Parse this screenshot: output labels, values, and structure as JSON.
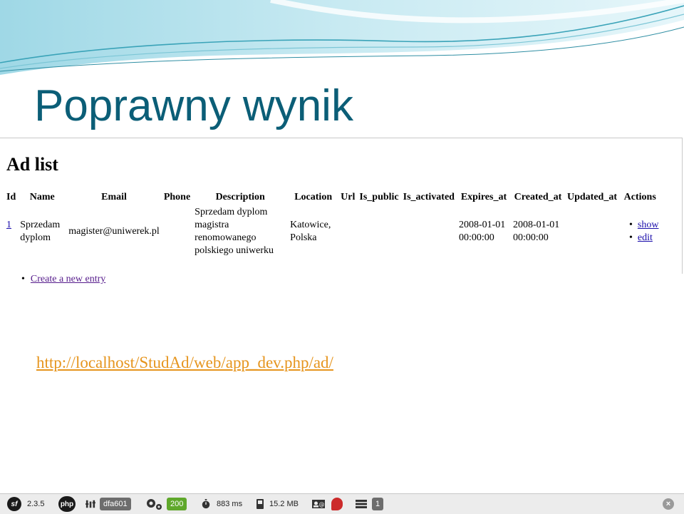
{
  "slide": {
    "title": "Poprawny wynik",
    "url": "http://localhost/StudAd/web/app_dev.php/ad/"
  },
  "page": {
    "heading": "Ad list",
    "columns": [
      "Id",
      "Name",
      "Email",
      "Phone",
      "Description",
      "Location",
      "Url",
      "Is_public",
      "Is_activated",
      "Expires_at",
      "Created_at",
      "Updated_at",
      "Actions"
    ],
    "row": {
      "id": "1",
      "name": "Sprzedam dyplom",
      "email": "magister@uniwerek.pl",
      "phone": "",
      "description": "Sprzedam dyplom magistra renomowanego polskiego uniwerku",
      "location": "Katowice, Polska",
      "url": "",
      "is_public": "",
      "is_activated": "",
      "expires_at": "2008-01-01 00:00:00",
      "created_at": "2008-01-01 00:00:00",
      "updated_at": "",
      "actions": [
        "show",
        "edit"
      ]
    },
    "create_link": "Create a new entry"
  },
  "toolbar": {
    "sf_logo": "sf",
    "symfony_version": "2.3.5",
    "php_logo": "php",
    "token": "dfa601",
    "status_code": "200",
    "time": "883 ms",
    "memory": "15.2 MB",
    "db_queries": "1",
    "status_color": "#5fa82b",
    "accent": "#0b5e77"
  }
}
